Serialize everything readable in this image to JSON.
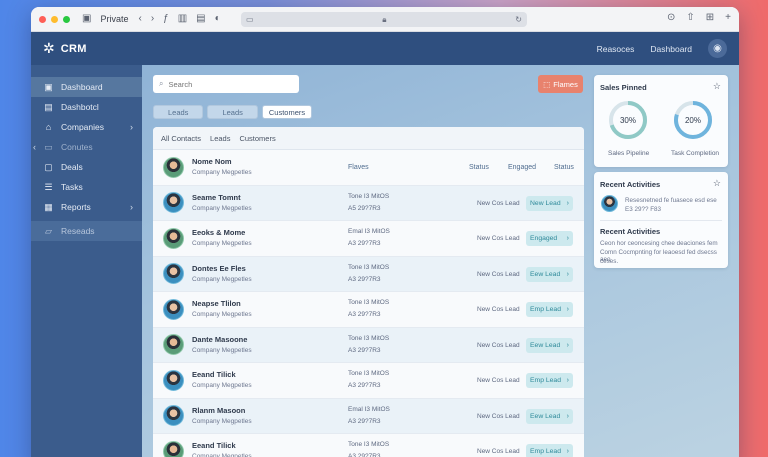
{
  "browser": {
    "tab_label": "Private",
    "url": "",
    "colors": {
      "close": "#fe5f57",
      "min": "#febc2e",
      "max": "#28c840"
    }
  },
  "header": {
    "app_name": "CRM",
    "links": [
      "Reasoces",
      "Dashboard"
    ]
  },
  "sidebar": {
    "items": [
      {
        "label": "Dashboard",
        "icon": "dashboard-icon",
        "active": true,
        "chevron": false
      },
      {
        "label": "Dashbotcl",
        "icon": "document-icon",
        "active": false,
        "chevron": false
      },
      {
        "label": "Companies",
        "icon": "home-icon",
        "active": false,
        "chevron": true
      },
      {
        "label": "Conutes",
        "icon": "monitor-icon",
        "active": false,
        "chevron": false,
        "dim": true
      },
      {
        "label": "Deals",
        "icon": "inbox-icon",
        "active": false,
        "chevron": false
      },
      {
        "label": "Tasks",
        "icon": "tasks-icon",
        "active": false,
        "chevron": false
      },
      {
        "label": "Reports",
        "icon": "reports-icon",
        "active": false,
        "chevron": true
      },
      {
        "label": "Reseads",
        "icon": "chat-icon",
        "active": false,
        "chevron": false,
        "last": true
      }
    ]
  },
  "main": {
    "search_placeholder": "Search",
    "filter_tabs": [
      "Leads",
      "Leads",
      "Customers"
    ],
    "flames_button": "Flames",
    "table_tabs": [
      "All Contacts",
      "Leads",
      "Customers"
    ],
    "header_row": {
      "name": "Nome Nom",
      "company": "Company Megpetles",
      "col_flaves": "Flaves",
      "col_status": "Status",
      "col_engaged": "Engaged",
      "col_status2": "Status"
    },
    "rows": [
      {
        "name": "Seame Tomnt",
        "company": "Company Megpetles",
        "phone": "Tone I3 MitOS",
        "code": "A5 29?7R3",
        "status": "New Cos Lead",
        "badge": "New Lead"
      },
      {
        "name": "Eeoks & Mome",
        "company": "Company Megpetles",
        "phone": "Emal I3 MitOS",
        "code": "A3 29?7R3",
        "status": "New Cos Lead",
        "badge": "Engaged"
      },
      {
        "name": "Dontes Ee Fles",
        "company": "Company Megpetles",
        "phone": "Tone I3 MitOS",
        "code": "A3 29?7R3",
        "status": "New Cos Lead",
        "badge": "Eew Lead"
      },
      {
        "name": "Neapse Tlilon",
        "company": "Company Megpetles",
        "phone": "Tone I3 MitOS",
        "code": "A3 29?7R3",
        "status": "New Cos Lead",
        "badge": "Emp Lead"
      },
      {
        "name": "Dante Masoone",
        "company": "Company Megpetles",
        "phone": "Tone I3 MitOS",
        "code": "A3 29?7R3",
        "status": "New Cos Lead",
        "badge": "Eew Lead"
      },
      {
        "name": "Eeand Tilick",
        "company": "Company Megpetles",
        "phone": "Tone I3 MitOS",
        "code": "A3 29?7R3",
        "status": "New Cos Lead",
        "badge": "Emp Lead"
      },
      {
        "name": "Rlanm Masoon",
        "company": "Company Megpetles",
        "phone": "Emal I3 MitOS",
        "code": "A3 29?7R3",
        "status": "New Cos Lead",
        "badge": "Eew Lead"
      },
      {
        "name": "Eeand Tilick",
        "company": "Company Megpetles",
        "phone": "Tone I3 MitOS",
        "code": "A3 29?7R3",
        "status": "New Cos Lead",
        "badge": "Emp Lead"
      }
    ]
  },
  "panels": {
    "sales": {
      "title": "Sales Pinned",
      "rings": [
        {
          "value": "30%",
          "label": "Sales Pipeline",
          "fraction": 0.3,
          "color": "#8fc9c6"
        },
        {
          "value": "20%",
          "label": "Task Completion",
          "fraction": 0.2,
          "color": "#6fb4dd"
        }
      ]
    },
    "activities": {
      "title": "Recent Activities",
      "line1": "Resesnetned fe fuasece esd ese",
      "line2": "E3 29?? F83",
      "subtitle": "Recent Activities",
      "para1": "Ceon hor ceoncesing chee deaciones fem",
      "para2": "Comn Cocmpnting for leaoesd fed dsecss aeo",
      "para3": "ceses."
    }
  }
}
